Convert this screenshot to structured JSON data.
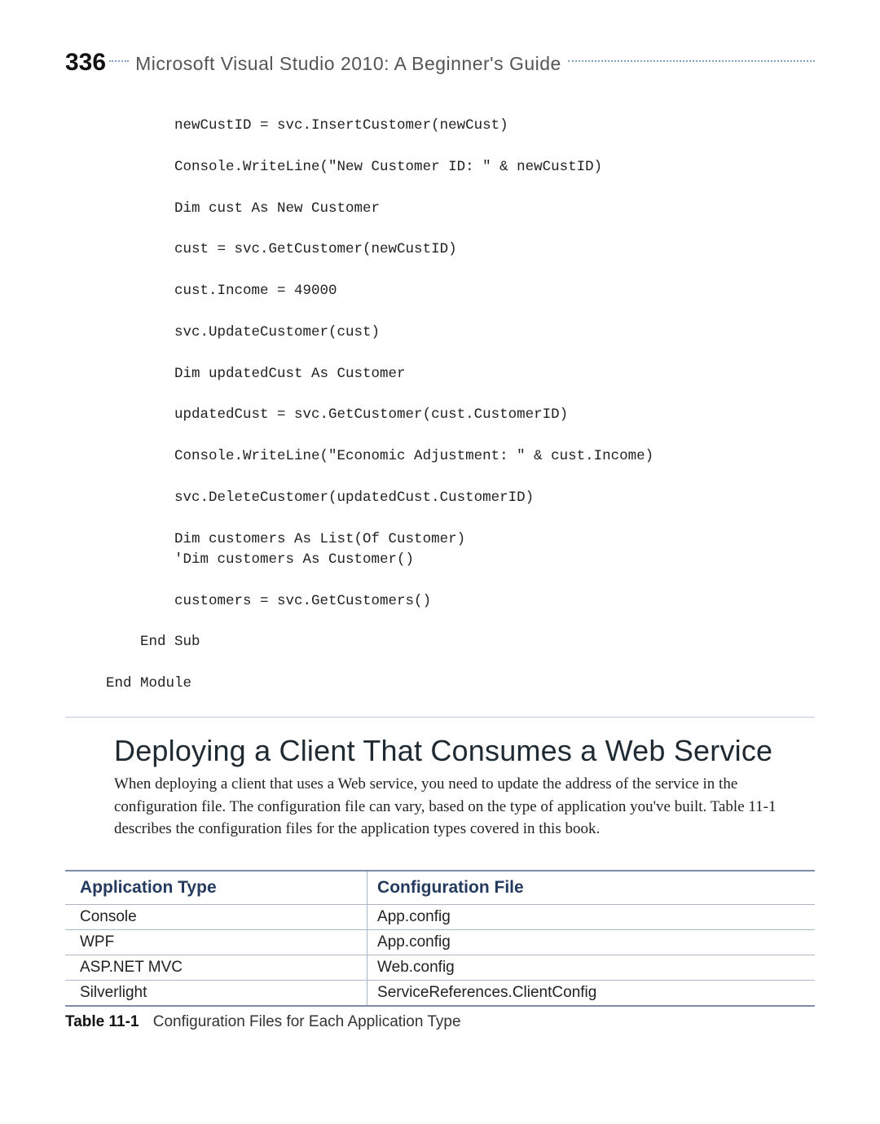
{
  "header": {
    "page_number": "336",
    "running_title": "Microsoft Visual Studio 2010: A Beginner's Guide"
  },
  "code": "        newCustID = svc.InsertCustomer(newCust)\n\n        Console.WriteLine(\"New Customer ID: \" & newCustID)\n\n        Dim cust As New Customer\n\n        cust = svc.GetCustomer(newCustID)\n\n        cust.Income = 49000\n\n        svc.UpdateCustomer(cust)\n\n        Dim updatedCust As Customer\n\n        updatedCust = svc.GetCustomer(cust.CustomerID)\n\n        Console.WriteLine(\"Economic Adjustment: \" & cust.Income)\n\n        svc.DeleteCustomer(updatedCust.CustomerID)\n\n        Dim customers As List(Of Customer)\n        'Dim customers As Customer()\n\n        customers = svc.GetCustomers()\n\n    End Sub\n\nEnd Module",
  "section": {
    "title": "Deploying a Client That Consumes a Web Service",
    "body": "When deploying a client that uses a Web service, you need to update the address of the service in the configuration file. The configuration file can vary, based on the type of application you've built. Table 11-1 describes the configuration files for the application types covered in this book."
  },
  "table": {
    "headers": [
      "Application Type",
      "Configuration File"
    ],
    "rows": [
      [
        "Console",
        "App.config"
      ],
      [
        "WPF",
        "App.config"
      ],
      [
        "ASP.NET MVC",
        "Web.config"
      ],
      [
        "Silverlight",
        "ServiceReferences.ClientConfig"
      ]
    ],
    "caption_label": "Table 11-1",
    "caption_text": "Configuration Files for Each Application Type"
  }
}
